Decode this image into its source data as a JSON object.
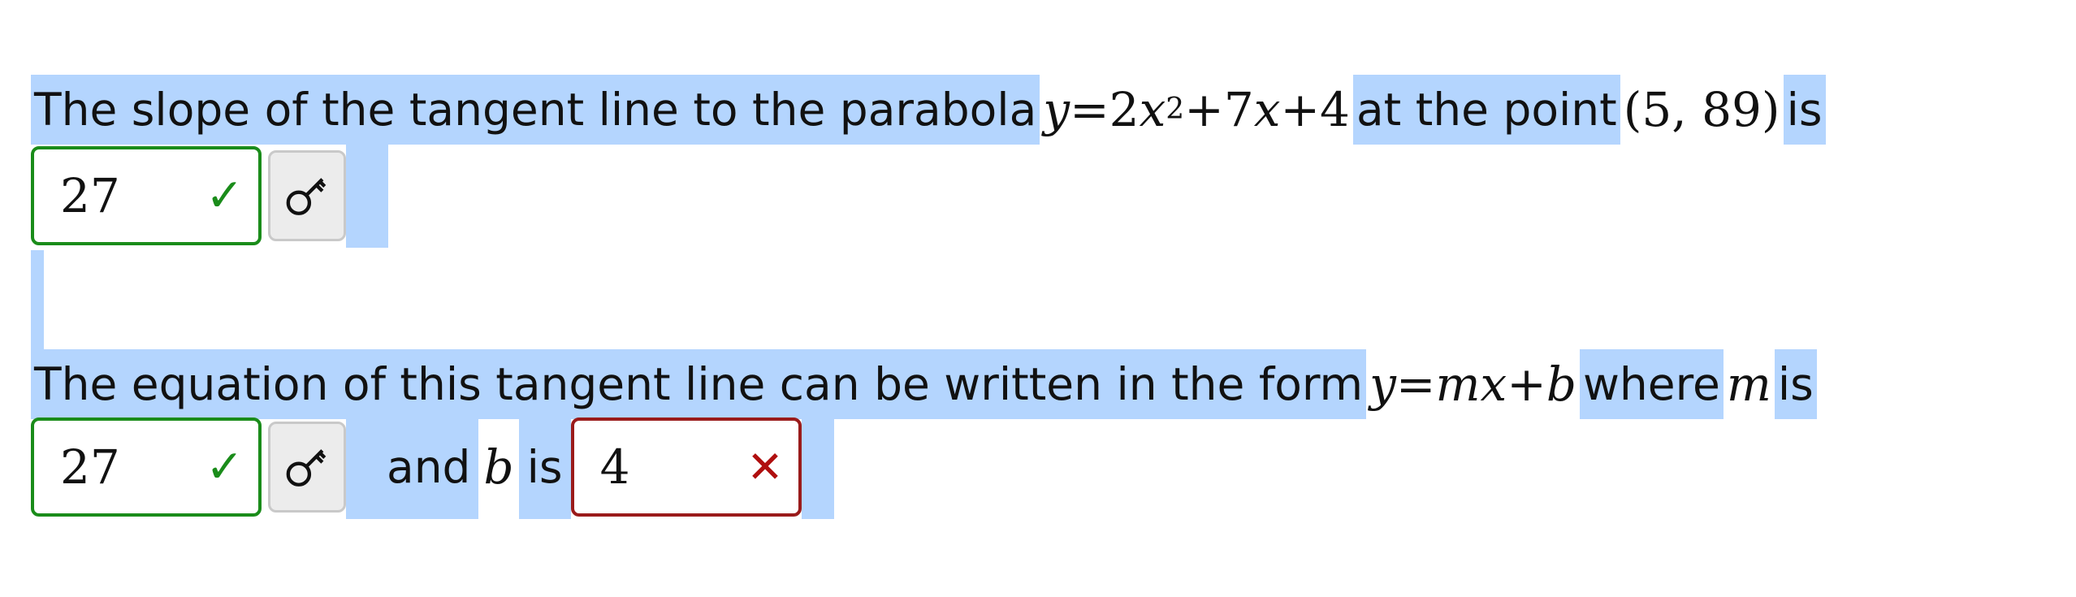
{
  "question1": {
    "text_before": "The slope of the tangent line to the parabola",
    "equation": {
      "lhs": "y",
      "eq": " = ",
      "c1": "2",
      "x": "x",
      "exp": "2",
      "plus1": " + ",
      "c2": "7",
      "x2": "x",
      "plus2": " + ",
      "c3": "4"
    },
    "text_middle": "at the point",
    "point": "(5, 89)",
    "text_after": "is"
  },
  "answer1": {
    "value": "27",
    "status": "correct",
    "status_mark": "✓"
  },
  "question2": {
    "text_before": "The equation of this tangent line can be written in the form",
    "equation": {
      "lhs": "y",
      "eq": " = ",
      "m": "mx",
      "plus": " + ",
      "b": "b"
    },
    "text_middle": "where",
    "m_var": "m",
    "text_after": "is"
  },
  "answer2": {
    "value": "27",
    "status": "correct",
    "status_mark": "✓"
  },
  "between": {
    "text_and": "and",
    "b_var": "b",
    "text_is": "is"
  },
  "answer3": {
    "value": "4",
    "status": "incorrect",
    "status_mark": "✕"
  },
  "icons": {
    "answer_key": "key-icon"
  },
  "colors": {
    "selection": "#b4d5fe",
    "correct": "#1a8c1a",
    "incorrect": "#9a1b1b"
  }
}
